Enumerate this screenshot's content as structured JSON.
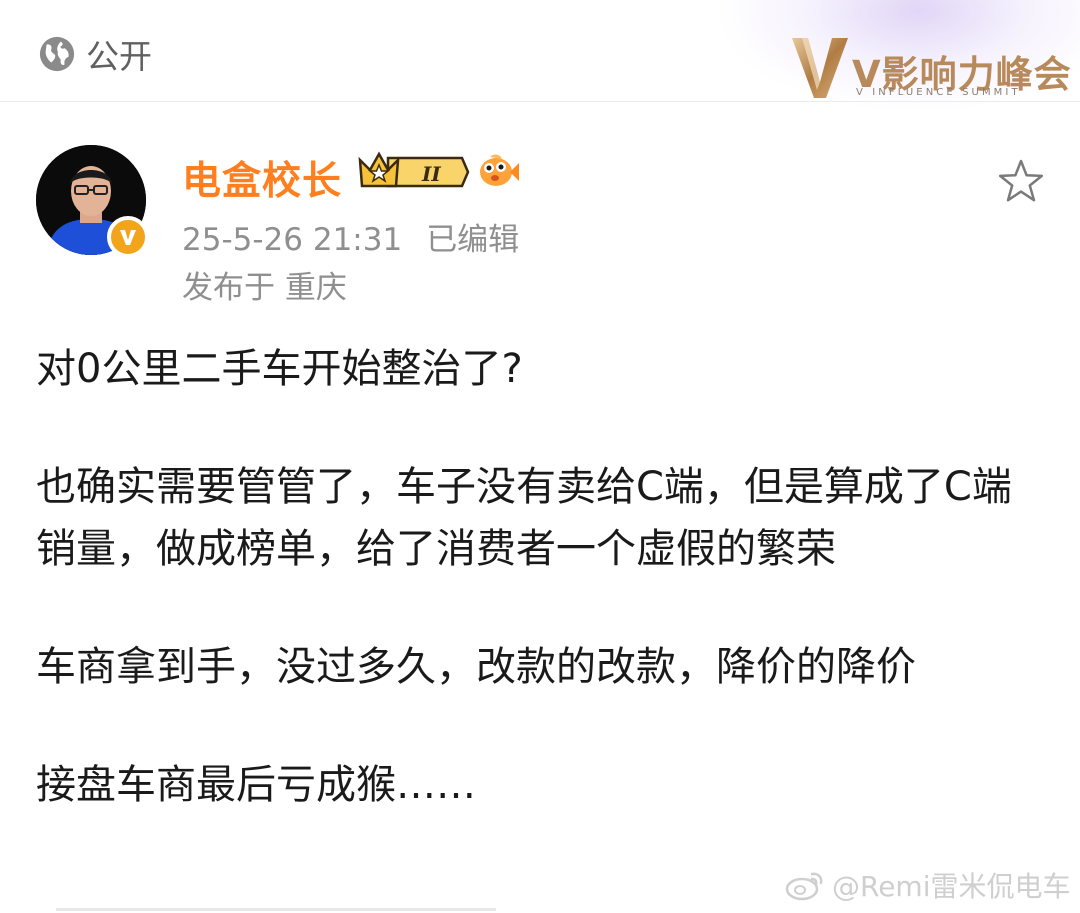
{
  "header": {
    "visibility_label": "公开",
    "banner": {
      "title": "V影响力峰会",
      "subtitle": "V INFLUENCE SUMMIT"
    }
  },
  "post": {
    "author": {
      "name": "电盒校长",
      "badge_level": "II",
      "name_color": "#ff7f1e"
    },
    "timestamp": "25-5-26 21:31",
    "edited_label": "已编辑",
    "location": "发布于 重庆",
    "paragraphs": [
      "对0公里二手车开始整治了?",
      "也确实需要管管了，车子没有卖给C端，但是算成了C端销量，做成榜单，给了消费者一个虚假的繁荣",
      "车商拿到手，没过多久，改款的改款，降价的降价",
      "接盘车商最后亏成猴……"
    ]
  },
  "watermark": "@Remi雷米侃电车",
  "colors": {
    "accent": "#ff7f1e",
    "verified": "#f2a51b",
    "banner_gold": "#b8895a"
  },
  "icons": [
    "globe-icon",
    "star-icon",
    "verified-v-icon",
    "crown-level-icon",
    "fish-emoji-icon",
    "weibo-icon"
  ]
}
